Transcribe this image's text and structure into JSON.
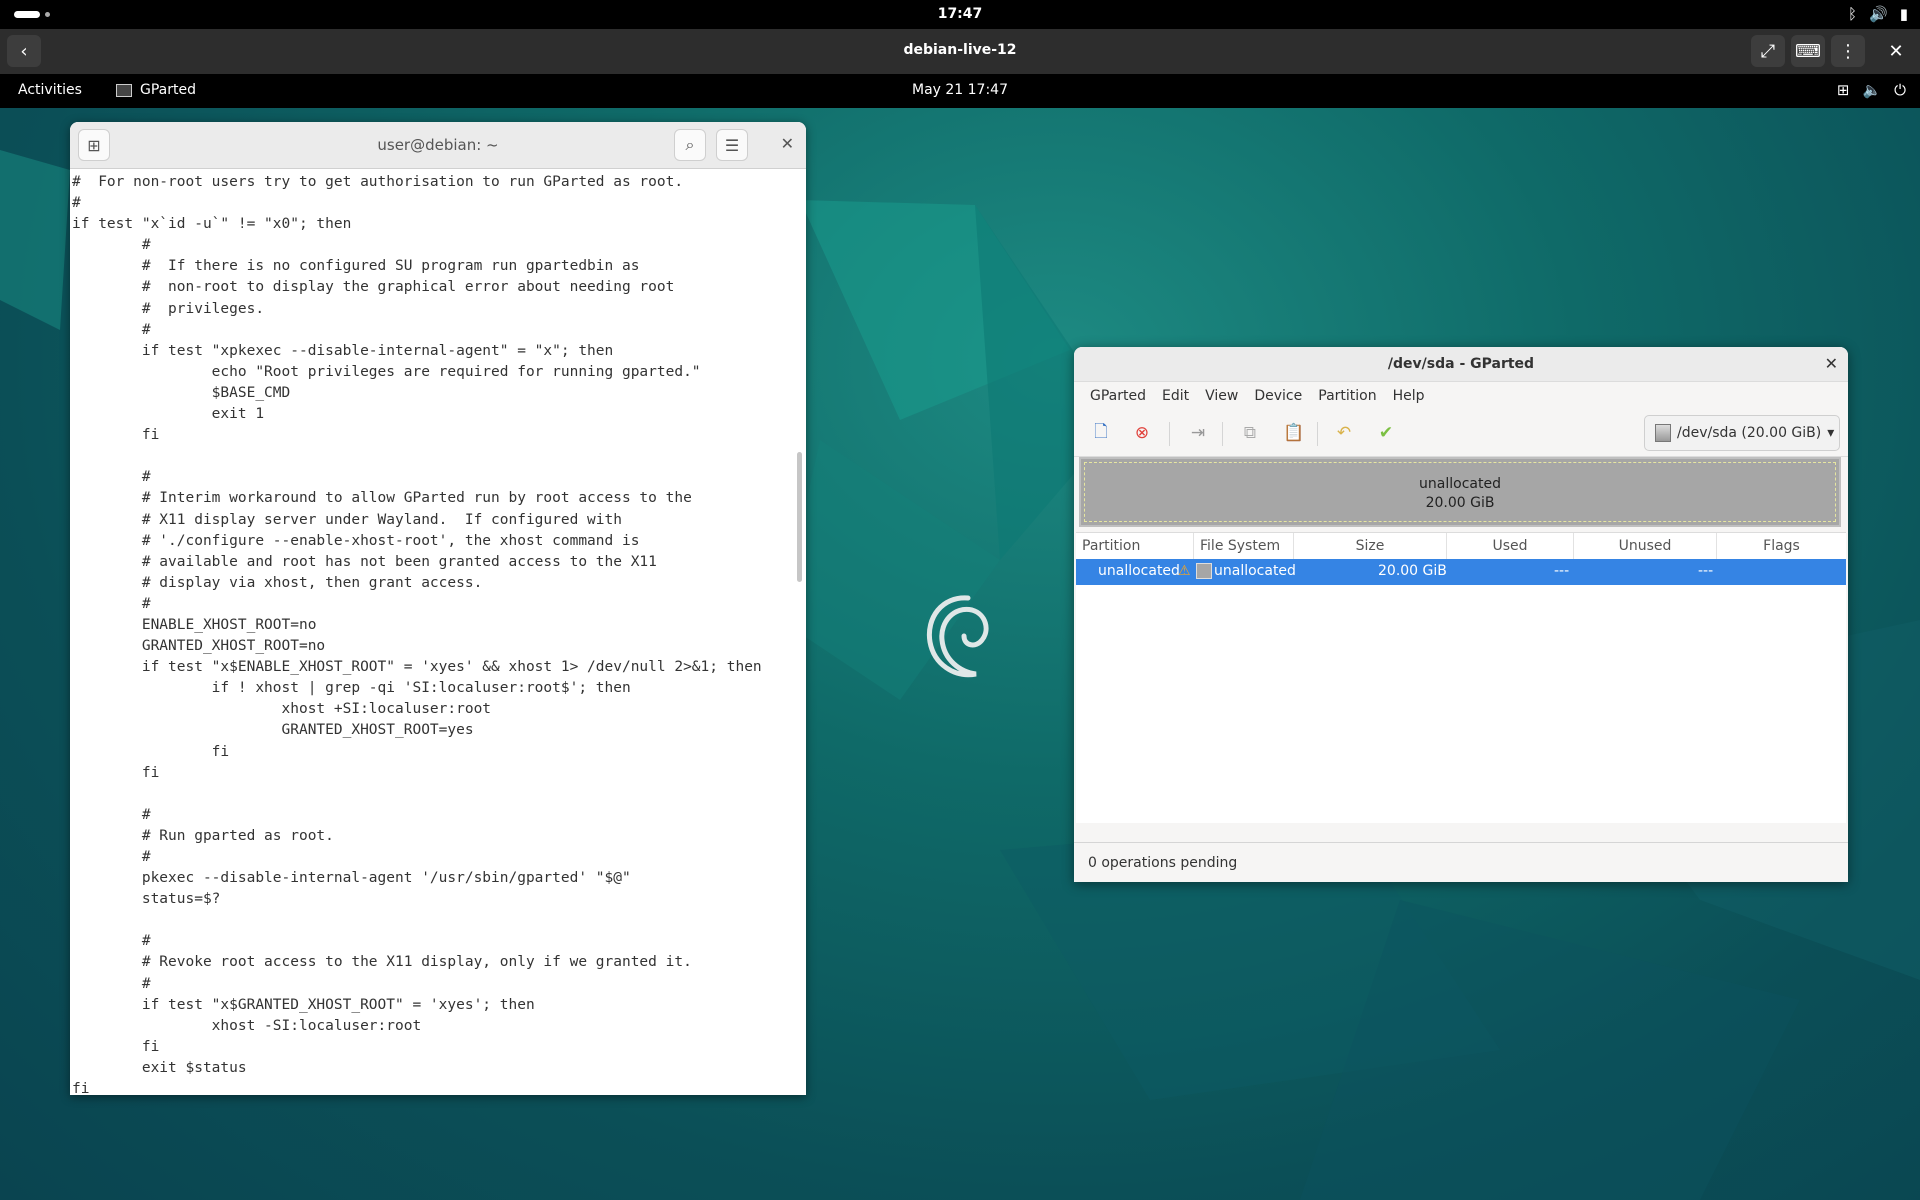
{
  "host": {
    "time": "17:47",
    "viewer_title": "debian-live-12"
  },
  "panel": {
    "activities": "Activities",
    "app_name": "GParted",
    "datetime": "May 21  17:47"
  },
  "terminal": {
    "title": "user@debian: ~",
    "lines": [
      "#  For non-root users try to get authorisation to run GParted as root.",
      "#",
      "if test \"x`id -u`\" != \"x0\"; then",
      "        #",
      "        #  If there is no configured SU program run gpartedbin as",
      "        #  non-root to display the graphical error about needing root",
      "        #  privileges.",
      "        #",
      "        if test \"xpkexec --disable-internal-agent\" = \"x\"; then",
      "                echo \"Root privileges are required for running gparted.\"",
      "                $BASE_CMD",
      "                exit 1",
      "        fi",
      "",
      "        #",
      "        # Interim workaround to allow GParted run by root access to the",
      "        # X11 display server under Wayland.  If configured with",
      "        # './configure --enable-xhost-root', the xhost command is",
      "        # available and root has not been granted access to the X11",
      "        # display via xhost, then grant access.",
      "        #",
      "        ENABLE_XHOST_ROOT=no",
      "        GRANTED_XHOST_ROOT=no",
      "        if test \"x$ENABLE_XHOST_ROOT\" = 'xyes' && xhost 1> /dev/null 2>&1; then",
      "                if ! xhost | grep -qi 'SI:localuser:root$'; then",
      "                        xhost +SI:localuser:root",
      "                        GRANTED_XHOST_ROOT=yes",
      "                fi",
      "        fi",
      "",
      "        #",
      "        # Run gparted as root.",
      "        #",
      "        pkexec --disable-internal-agent '/usr/sbin/gparted' \"$@\"",
      "        status=$?",
      "",
      "        #",
      "        # Revoke root access to the X11 display, only if we granted it.",
      "        #",
      "        if test \"x$GRANTED_XHOST_ROOT\" = 'xyes'; then",
      "                xhost -SI:localuser:root",
      "        fi",
      "        exit $status",
      "fi"
    ]
  },
  "gparted": {
    "title": "/dev/sda - GParted",
    "menu": [
      "GParted",
      "Edit",
      "View",
      "Device",
      "Partition",
      "Help"
    ],
    "device": "/dev/sda (20.00 GiB)",
    "disk_map": {
      "label": "unallocated",
      "size": "20.00 GiB"
    },
    "columns": [
      "Partition",
      "File System",
      "Size",
      "Used",
      "Unused",
      "Flags"
    ],
    "row": {
      "partition": "unallocated",
      "filesystem": "unallocated",
      "size": "20.00 GiB",
      "used": "---",
      "unused": "---",
      "flags": ""
    },
    "status": "0 operations pending"
  }
}
